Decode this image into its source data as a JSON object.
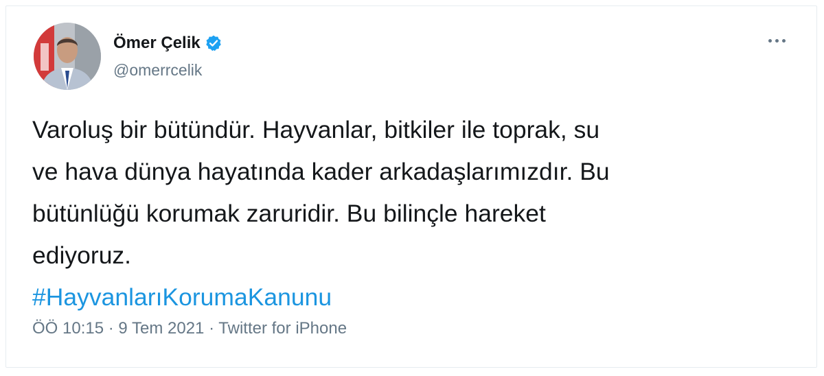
{
  "author": {
    "name": "Ömer Çelik",
    "handle": "@omerrcelik",
    "verified_icon": "verified-badge-icon",
    "verified_color": "#1da1f2"
  },
  "tweet": {
    "lines": [
      "Varoluş bir bütündür. Hayvanlar, bitkiler ile toprak, su",
      "ve hava dünya hayatında kader arkadaşlarımızdır. Bu",
      "bütünlüğü korumak zaruridir. Bu bilinçle hareket",
      "ediyoruz."
    ],
    "hashtag": "#HayvanlarıKorumaKanunu",
    "hashtag_color": "#1b95e0"
  },
  "meta": {
    "time": "ÖÖ 10:15",
    "date": "9 Tem 2021",
    "source": "Twitter for iPhone",
    "separator": "·"
  },
  "menu_icon": "more-options-icon"
}
